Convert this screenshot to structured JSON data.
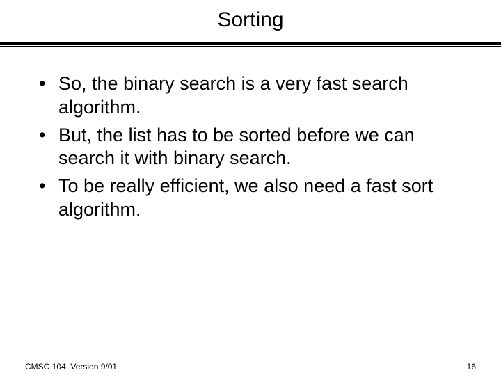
{
  "title": "Sorting",
  "bullets": [
    "So, the binary search is a very fast search algorithm.",
    "But, the list has to be sorted before we can search it with binary search.",
    "To be really efficient, we also need a fast sort algorithm."
  ],
  "footer": {
    "left": "CMSC 104, Version 9/01",
    "right": "16"
  }
}
